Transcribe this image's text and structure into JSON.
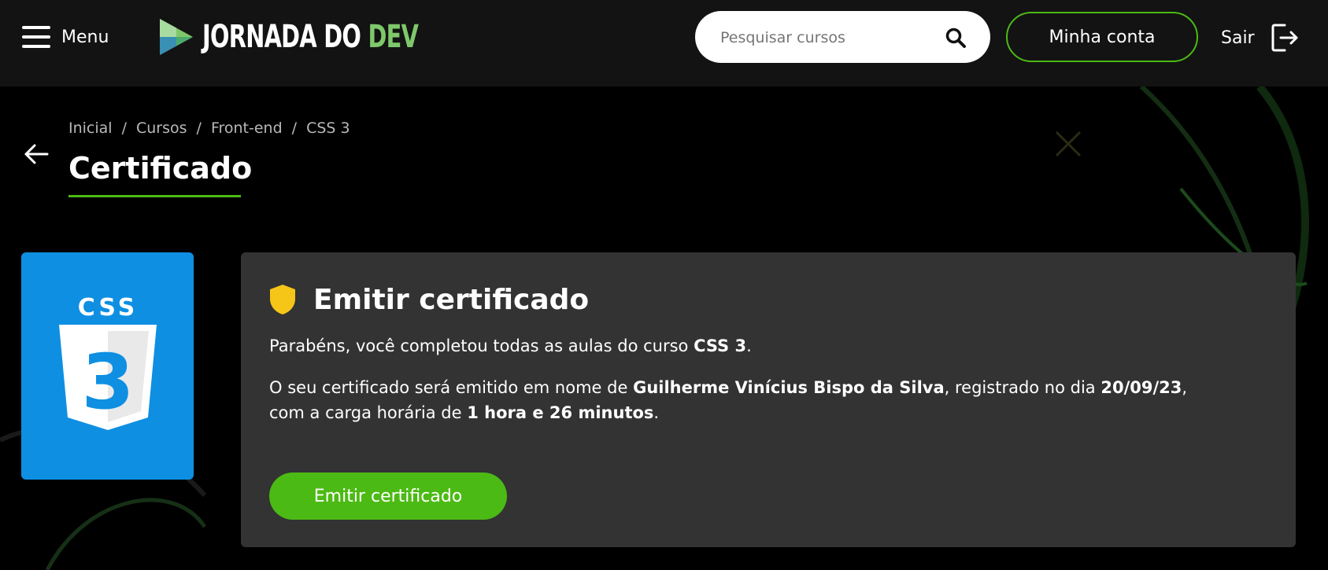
{
  "header": {
    "menu_label": "Menu",
    "logo_text_main": "JORNADA DO",
    "logo_text_accent": "DEV",
    "search_placeholder": "Pesquisar cursos",
    "account_label": "Minha conta",
    "logout_label": "Sair"
  },
  "breadcrumb": [
    "Inicial",
    "Cursos",
    "Front-end",
    "CSS 3"
  ],
  "breadcrumb_separator": "/",
  "page": {
    "title": "Certificado"
  },
  "course": {
    "logo_text": "CSS",
    "logo_number": "3"
  },
  "certificate": {
    "heading": "Emitir certificado",
    "line1_prefix": "Parabéns, você completou todas as aulas do curso ",
    "course_name": "CSS 3",
    "line1_suffix": ".",
    "line2_prefix": "O seu certificado será emitido em nome de ",
    "student_name": "Guilherme Vinícius Bispo da Silva",
    "line2_mid": ", registrado no dia ",
    "date": "20/09/23",
    "line2_suffix": ",",
    "line3_prefix": "com a carga horária de ",
    "workload": "1 hora e 26 minutos",
    "line3_suffix": ".",
    "button_label": "Emitir certificado"
  },
  "colors": {
    "accent_green": "#4cba14",
    "logo_green": "#7ec86b",
    "header_bg": "#131313",
    "card_bg": "#333333",
    "css_blue": "#0e8fe2",
    "shield_yellow": "#f5c518"
  }
}
